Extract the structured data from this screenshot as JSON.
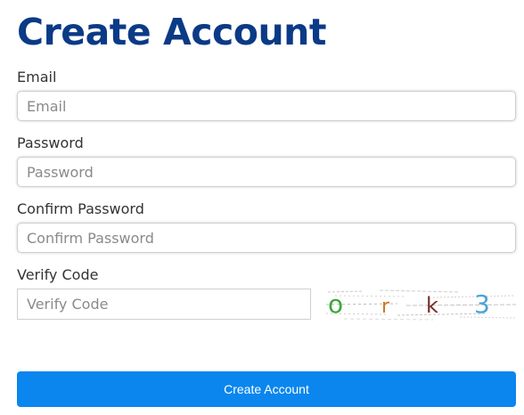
{
  "page": {
    "title": "Create Account"
  },
  "form": {
    "email": {
      "label": "Email",
      "placeholder": "Email",
      "value": ""
    },
    "password": {
      "label": "Password",
      "placeholder": "Password",
      "value": ""
    },
    "confirm_password": {
      "label": "Confirm Password",
      "placeholder": "Confirm Password",
      "value": ""
    },
    "verify_code": {
      "label": "Verify Code",
      "placeholder": "Verify Code",
      "value": ""
    },
    "captcha": {
      "chars": [
        "o",
        "r",
        "k",
        "3"
      ],
      "colors": [
        "#3aa83a",
        "#c87a22",
        "#7a2e2e",
        "#4aa3d8"
      ]
    },
    "submit_label": "Create Account"
  },
  "colors": {
    "title": "#0b3a86",
    "button": "#0a86ee"
  }
}
